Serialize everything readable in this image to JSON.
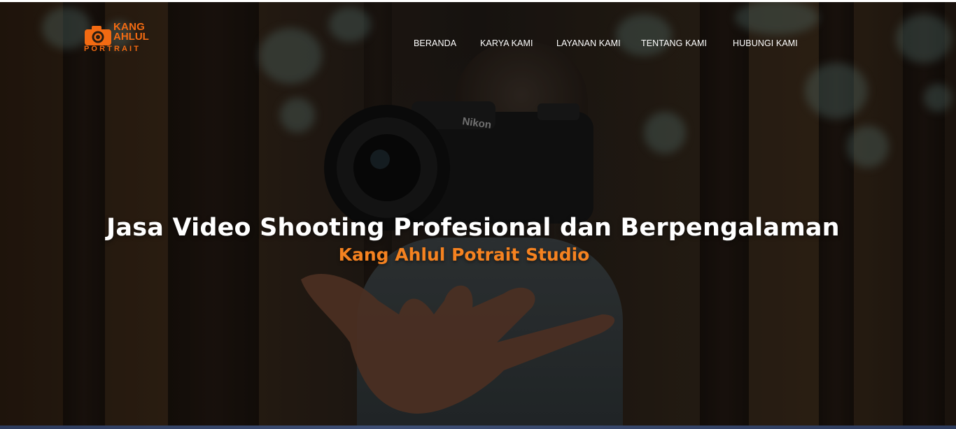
{
  "brand": {
    "line1": "KANG",
    "line2": "AHLUL",
    "line3": "PORTRAIT",
    "accent_color": "#f26a12",
    "logo_icon": "camera-icon"
  },
  "nav": {
    "items": [
      {
        "label": "BERANDA"
      },
      {
        "label": "KARYA KAMI"
      },
      {
        "label": "LAYANAN KAMI"
      },
      {
        "label": "TENTANG KAMI"
      },
      {
        "label": "HUBUNGI KAMI"
      }
    ]
  },
  "hero": {
    "title": "Jasa Video Shooting Profesional dan Berpengalaman",
    "subtitle": "Kang Ahlul Potrait Studio",
    "subtitle_color": "#f58220",
    "camera_brand": "Nikon"
  }
}
